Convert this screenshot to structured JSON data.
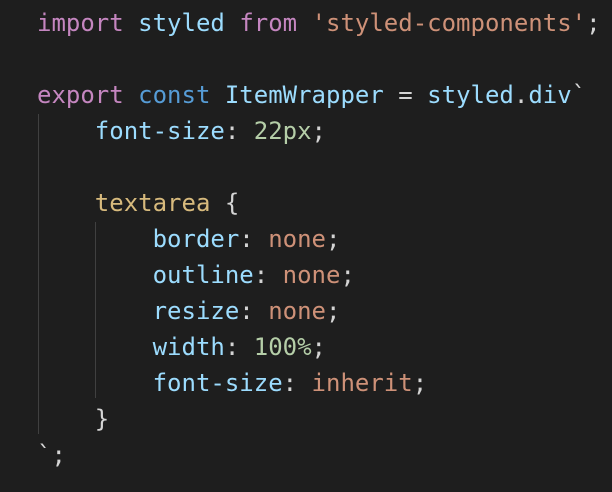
{
  "editor": {
    "background": "#1e1e1e",
    "colors": {
      "keyword": "#c586c0",
      "storage": "#569cd6",
      "variable": "#9cdcfe",
      "string": "#ce9178",
      "number": "#b5cea8",
      "selector": "#d7ba7d",
      "function": "#dcdcaa",
      "text": "#d4d4d4"
    },
    "lines": [
      {
        "tokens": [
          {
            "t": "import",
            "k": "kw"
          },
          {
            "t": " ",
            "k": "plain"
          },
          {
            "t": "styled",
            "k": "ident"
          },
          {
            "t": " ",
            "k": "plain"
          },
          {
            "t": "from",
            "k": "kw"
          },
          {
            "t": " ",
            "k": "plain"
          },
          {
            "t": "'styled-components'",
            "k": "str"
          },
          {
            "t": ";",
            "k": "plain"
          }
        ]
      },
      {
        "tokens": []
      },
      {
        "tokens": [
          {
            "t": "export",
            "k": "kw"
          },
          {
            "t": " ",
            "k": "plain"
          },
          {
            "t": "const",
            "k": "kw-blue"
          },
          {
            "t": " ",
            "k": "plain"
          },
          {
            "t": "ItemWrapper",
            "k": "ident"
          },
          {
            "t": " = ",
            "k": "plain"
          },
          {
            "t": "styled",
            "k": "ident"
          },
          {
            "t": ".",
            "k": "plain"
          },
          {
            "t": "div",
            "k": "ident"
          },
          {
            "t": "`",
            "k": "plain"
          }
        ]
      },
      {
        "tokens": [
          {
            "t": "    ",
            "k": "plain"
          },
          {
            "t": "font-size",
            "k": "css-prop"
          },
          {
            "t": ": ",
            "k": "plain"
          },
          {
            "t": "22px",
            "k": "css-num"
          },
          {
            "t": ";",
            "k": "plain"
          }
        ]
      },
      {
        "tokens": []
      },
      {
        "tokens": [
          {
            "t": "    ",
            "k": "plain"
          },
          {
            "t": "textarea",
            "k": "css-sel"
          },
          {
            "t": " {",
            "k": "plain"
          }
        ]
      },
      {
        "tokens": [
          {
            "t": "        ",
            "k": "plain"
          },
          {
            "t": "border",
            "k": "css-prop"
          },
          {
            "t": ": ",
            "k": "plain"
          },
          {
            "t": "none",
            "k": "css-val"
          },
          {
            "t": ";",
            "k": "plain"
          }
        ]
      },
      {
        "tokens": [
          {
            "t": "        ",
            "k": "plain"
          },
          {
            "t": "outline",
            "k": "css-prop"
          },
          {
            "t": ": ",
            "k": "plain"
          },
          {
            "t": "none",
            "k": "css-val"
          },
          {
            "t": ";",
            "k": "plain"
          }
        ]
      },
      {
        "tokens": [
          {
            "t": "        ",
            "k": "plain"
          },
          {
            "t": "resize",
            "k": "css-prop"
          },
          {
            "t": ": ",
            "k": "plain"
          },
          {
            "t": "none",
            "k": "css-val"
          },
          {
            "t": ";",
            "k": "plain"
          }
        ]
      },
      {
        "tokens": [
          {
            "t": "        ",
            "k": "plain"
          },
          {
            "t": "width",
            "k": "css-prop"
          },
          {
            "t": ": ",
            "k": "plain"
          },
          {
            "t": "100%",
            "k": "css-num"
          },
          {
            "t": ";",
            "k": "plain"
          }
        ]
      },
      {
        "tokens": [
          {
            "t": "        ",
            "k": "plain"
          },
          {
            "t": "font-size",
            "k": "css-prop"
          },
          {
            "t": ": ",
            "k": "plain"
          },
          {
            "t": "inherit",
            "k": "css-val"
          },
          {
            "t": ";",
            "k": "plain"
          }
        ]
      },
      {
        "tokens": [
          {
            "t": "    ",
            "k": "plain"
          },
          {
            "t": "}",
            "k": "plain"
          }
        ]
      },
      {
        "tokens": [
          {
            "t": "`;",
            "k": "plain"
          }
        ]
      }
    ]
  }
}
